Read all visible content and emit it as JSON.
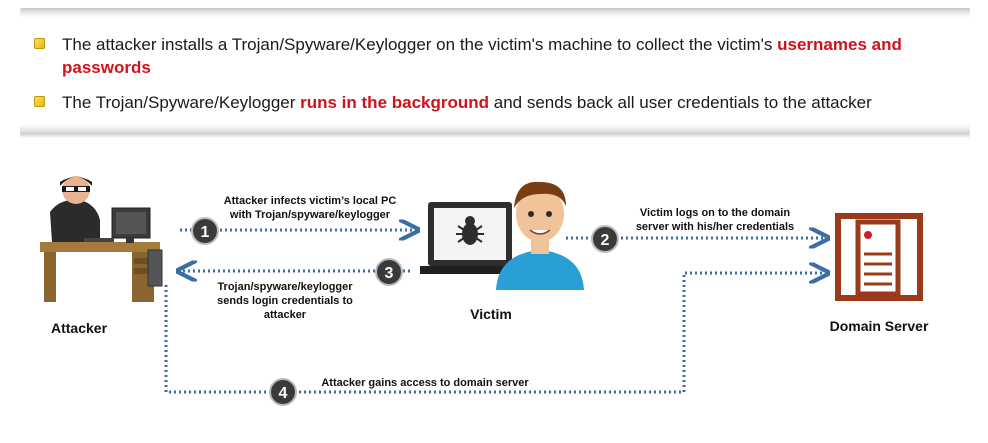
{
  "bullets": [
    {
      "text_before": "The attacker installs a Trojan/Spyware/Keylogger on the victim's machine to collect the victim's ",
      "highlight": "usernames and passwords",
      "text_after": ""
    },
    {
      "text_before": "The Trojan/Spyware/Keylogger ",
      "highlight": "runs in the background",
      "text_after": " and sends back all user credentials to the attacker"
    }
  ],
  "diagram": {
    "nodes": {
      "attacker": "Attacker",
      "victim": "Victim",
      "server": "Domain Server"
    },
    "steps": [
      {
        "number": "1",
        "lines": [
          "Attacker infects victim’s local PC",
          "with Trojan/spyware/keylogger"
        ]
      },
      {
        "number": "2",
        "lines": [
          "Victim logs on to the domain",
          "server with his/her credentials"
        ]
      },
      {
        "number": "3",
        "lines": [
          "Trojan/spyware/keylogger",
          "sends login credentials to",
          "attacker"
        ]
      },
      {
        "number": "4",
        "lines": [
          "Attacker gains access to domain server"
        ]
      }
    ]
  },
  "colors": {
    "highlight": "#d0121b",
    "arrow": "#3a6ea5",
    "step_badge": "#3a3a3a",
    "server": "#9b3b1c",
    "victim_shirt": "#2a9fd6"
  }
}
